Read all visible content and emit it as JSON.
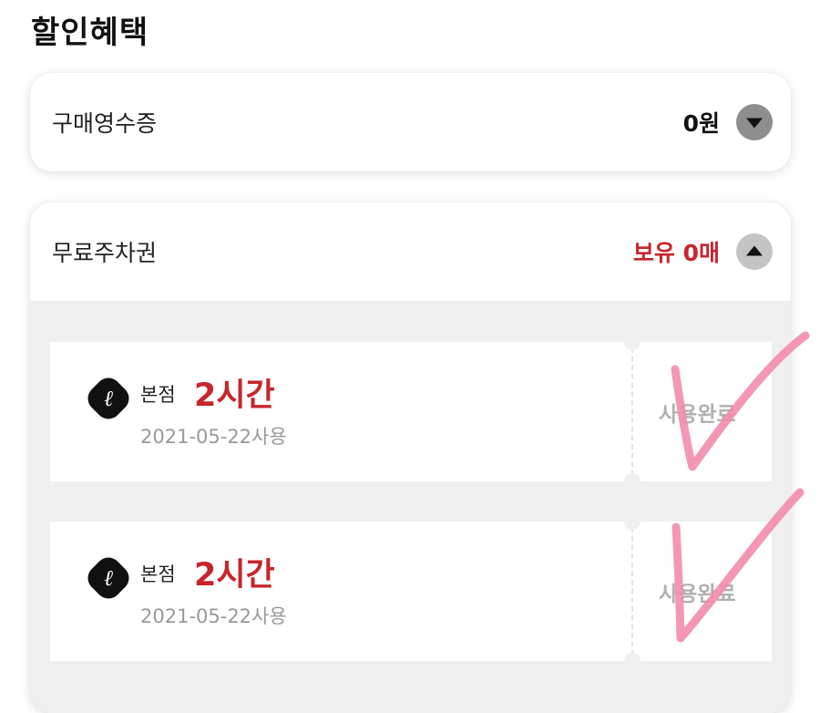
{
  "section_title": "할인혜택",
  "receipt": {
    "label": "구매영수증",
    "value": "0원",
    "toggle_icon": "chevron-down-icon"
  },
  "parking": {
    "label": "무료주차권",
    "value": "보유 0매",
    "toggle_icon": "chevron-up-icon",
    "coupons": [
      {
        "brand_icon": "lotte-logo-icon",
        "logo_glyph": "ℓ",
        "branch": "본점",
        "hours": "2시간",
        "used_date": "2021-05-22사용",
        "status": "사용완료"
      },
      {
        "brand_icon": "lotte-logo-icon",
        "logo_glyph": "ℓ",
        "branch": "본점",
        "hours": "2시간",
        "used_date": "2021-05-22사용",
        "status": "사용완료"
      }
    ]
  },
  "colors": {
    "accent_red": "#c8242b",
    "checkmark_pink": "#f28cab",
    "coupon_bg": "#efefef"
  }
}
